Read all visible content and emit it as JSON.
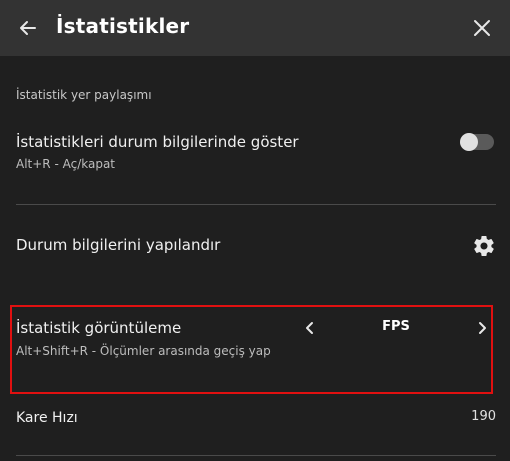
{
  "header": {
    "title": "İstatistikler"
  },
  "section": {
    "label": "İstatistik yer paylaşımı"
  },
  "rows": {
    "show_stats": {
      "title": "İstatistikleri durum bilgilerinde göster",
      "subtitle": "Alt+R - Aç/kapat",
      "toggle_on": false
    },
    "configure": {
      "title": "Durum bilgilerini yapılandır"
    },
    "display": {
      "title": "İstatistik görüntüleme",
      "subtitle": "Alt+Shift+R - Ölçümler arasında geçiş yap",
      "selected_value": "FPS"
    },
    "frame_rate": {
      "title": "Kare Hızı",
      "value": "190"
    }
  },
  "colors": {
    "background": "#1f1f1f",
    "header": "#333333",
    "highlight": "#e01010"
  },
  "icons": {
    "back": "arrow-left-icon",
    "close": "close-icon",
    "settings": "gear-icon",
    "prev": "chevron-left-icon",
    "next": "chevron-right-icon"
  }
}
